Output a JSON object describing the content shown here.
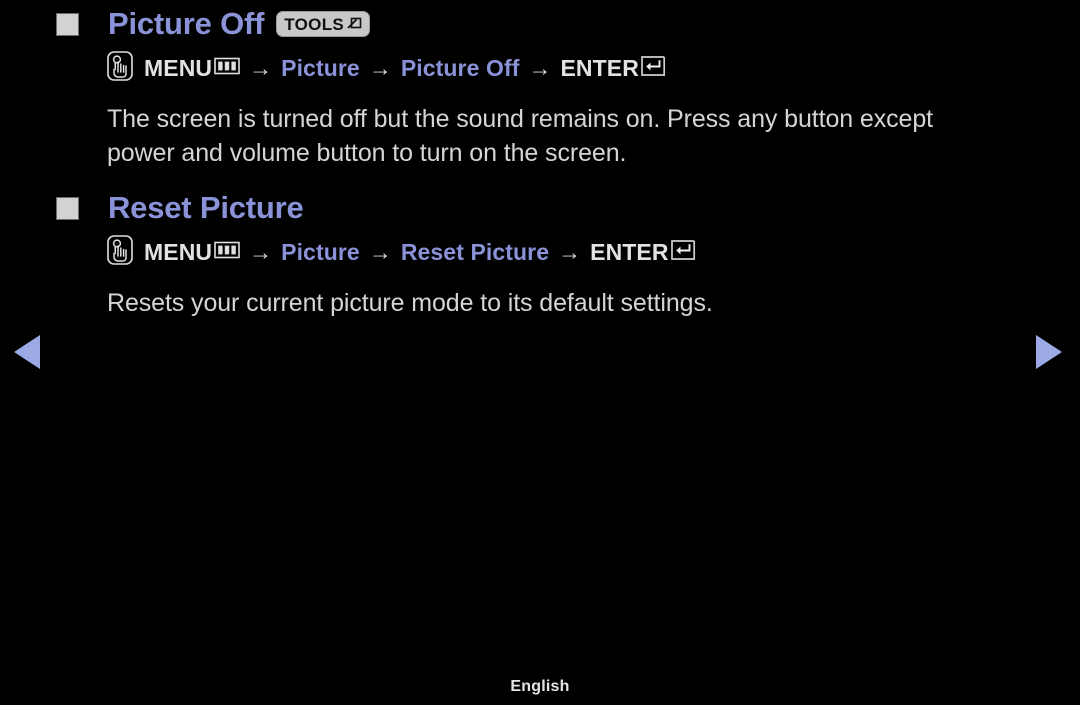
{
  "screen": {
    "background_color": "#000000",
    "accent_color": "#8b93d8",
    "text_color": "#d5d5d5",
    "arrow_color": "#9ba9e4"
  },
  "sections": [
    {
      "id": "picture-off",
      "heading": "Picture Off",
      "badge": {
        "label": "TOOLS",
        "icon": "tools-arrow-icon"
      },
      "path": {
        "hand_icon": "hand-press-icon",
        "menu_label": "MENU",
        "menu_icon": "menu-grid-icon",
        "arrow": "→",
        "step_1": "Picture",
        "step_2": "Picture Off",
        "enter_label": "ENTER",
        "enter_icon": "enter-return-icon"
      },
      "description": "The screen is turned off but the sound remains on. Press any button except power and volume button to turn on the screen."
    },
    {
      "id": "reset-picture",
      "heading": "Reset Picture",
      "badge": null,
      "path": {
        "hand_icon": "hand-press-icon",
        "menu_label": "MENU",
        "menu_icon": "menu-grid-icon",
        "arrow": "→",
        "step_1": "Picture",
        "step_2": "Reset Picture",
        "enter_label": "ENTER",
        "enter_icon": "enter-return-icon"
      },
      "description": "Resets your current picture mode to its default settings."
    }
  ],
  "navigation": {
    "prev_icon": "triangle-left-icon",
    "next_icon": "triangle-right-icon"
  },
  "footer": {
    "language": "English"
  }
}
